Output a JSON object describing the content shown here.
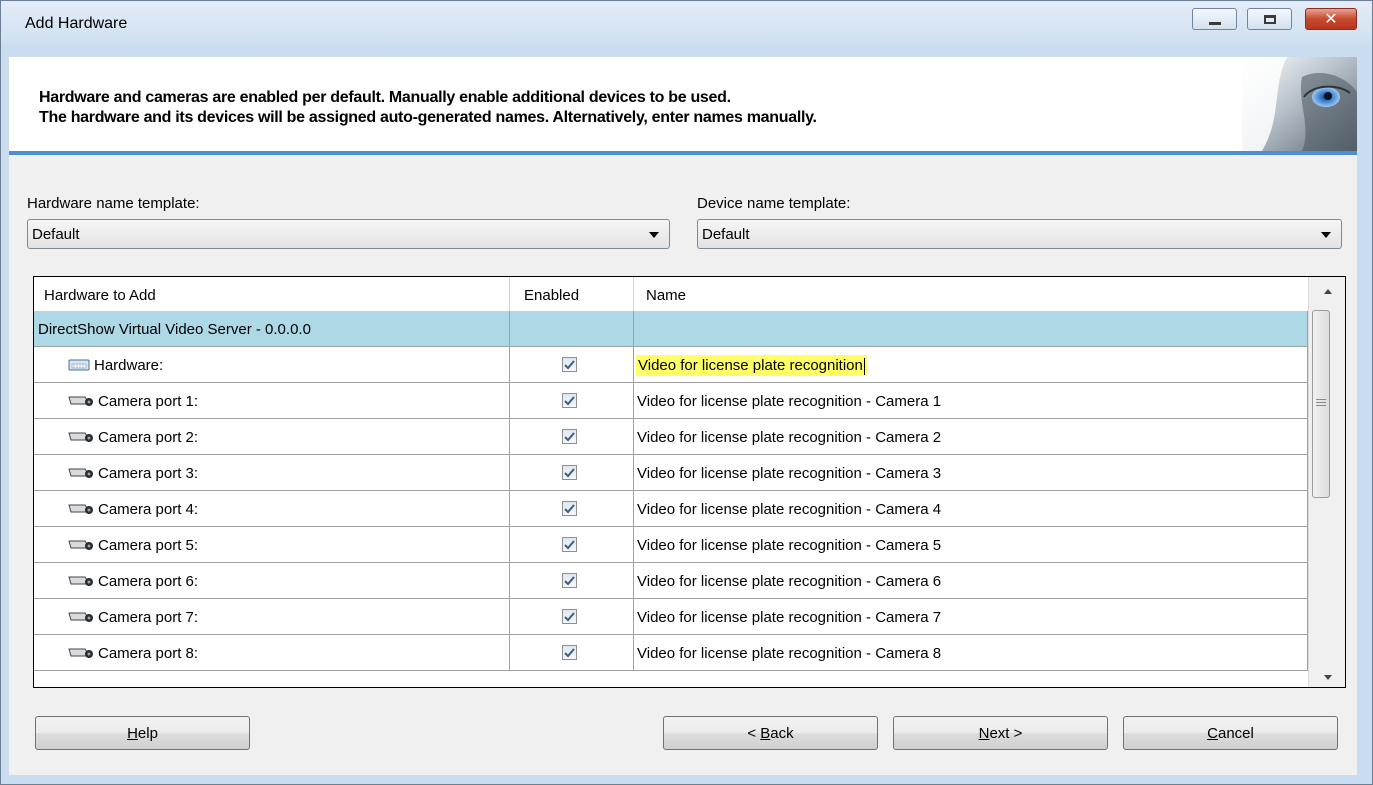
{
  "window": {
    "title": "Add Hardware"
  },
  "banner": {
    "line1": "Hardware and cameras are enabled per default. Manually enable additional devices to be used.",
    "line2": "The hardware and its devices will be assigned auto-generated names. Alternatively, enter names manually."
  },
  "templates": {
    "hardware_label": "Hardware name template:",
    "hardware_value": "Default",
    "device_label": "Device name template:",
    "device_value": "Default"
  },
  "grid": {
    "headers": [
      "Hardware to Add",
      "Enabled",
      "Name"
    ],
    "group": "DirectShow Virtual Video Server - 0.0.0.0",
    "rows": [
      {
        "label": "Hardware:",
        "icon": "hardware-icon",
        "enabled": true,
        "name": "Video for license plate recognition"
      },
      {
        "label": "Camera port 1:",
        "icon": "camera-icon",
        "enabled": true,
        "name": "Video for license plate recognition - Camera 1"
      },
      {
        "label": "Camera port 2:",
        "icon": "camera-icon",
        "enabled": true,
        "name": "Video for license plate recognition - Camera 2"
      },
      {
        "label": "Camera port 3:",
        "icon": "camera-icon",
        "enabled": true,
        "name": "Video for license plate recognition - Camera 3"
      },
      {
        "label": "Camera port 4:",
        "icon": "camera-icon",
        "enabled": true,
        "name": "Video for license plate recognition - Camera 4"
      },
      {
        "label": "Camera port 5:",
        "icon": "camera-icon",
        "enabled": true,
        "name": "Video for license plate recognition - Camera 5"
      },
      {
        "label": "Camera port 6:",
        "icon": "camera-icon",
        "enabled": true,
        "name": "Video for license plate recognition - Camera 6"
      },
      {
        "label": "Camera port 7:",
        "icon": "camera-icon",
        "enabled": true,
        "name": "Video for license plate recognition - Camera 7"
      },
      {
        "label": "Camera port 8:",
        "icon": "camera-icon",
        "enabled": true,
        "name": "Video for license plate recognition - Camera 8"
      }
    ]
  },
  "buttons": {
    "help": {
      "mnemonic": "H",
      "rest": "elp"
    },
    "back_prefix": "< ",
    "back": {
      "mnemonic": "B",
      "rest": "ack"
    },
    "next": {
      "mnemonic": "N",
      "rest": "ext >"
    },
    "cancel": {
      "mnemonic": "C",
      "rest": "ancel"
    }
  },
  "colors": {
    "group_row": "#add8e6",
    "edit_highlight": "#ffff66",
    "banner_rule": "#4d8fd6"
  }
}
